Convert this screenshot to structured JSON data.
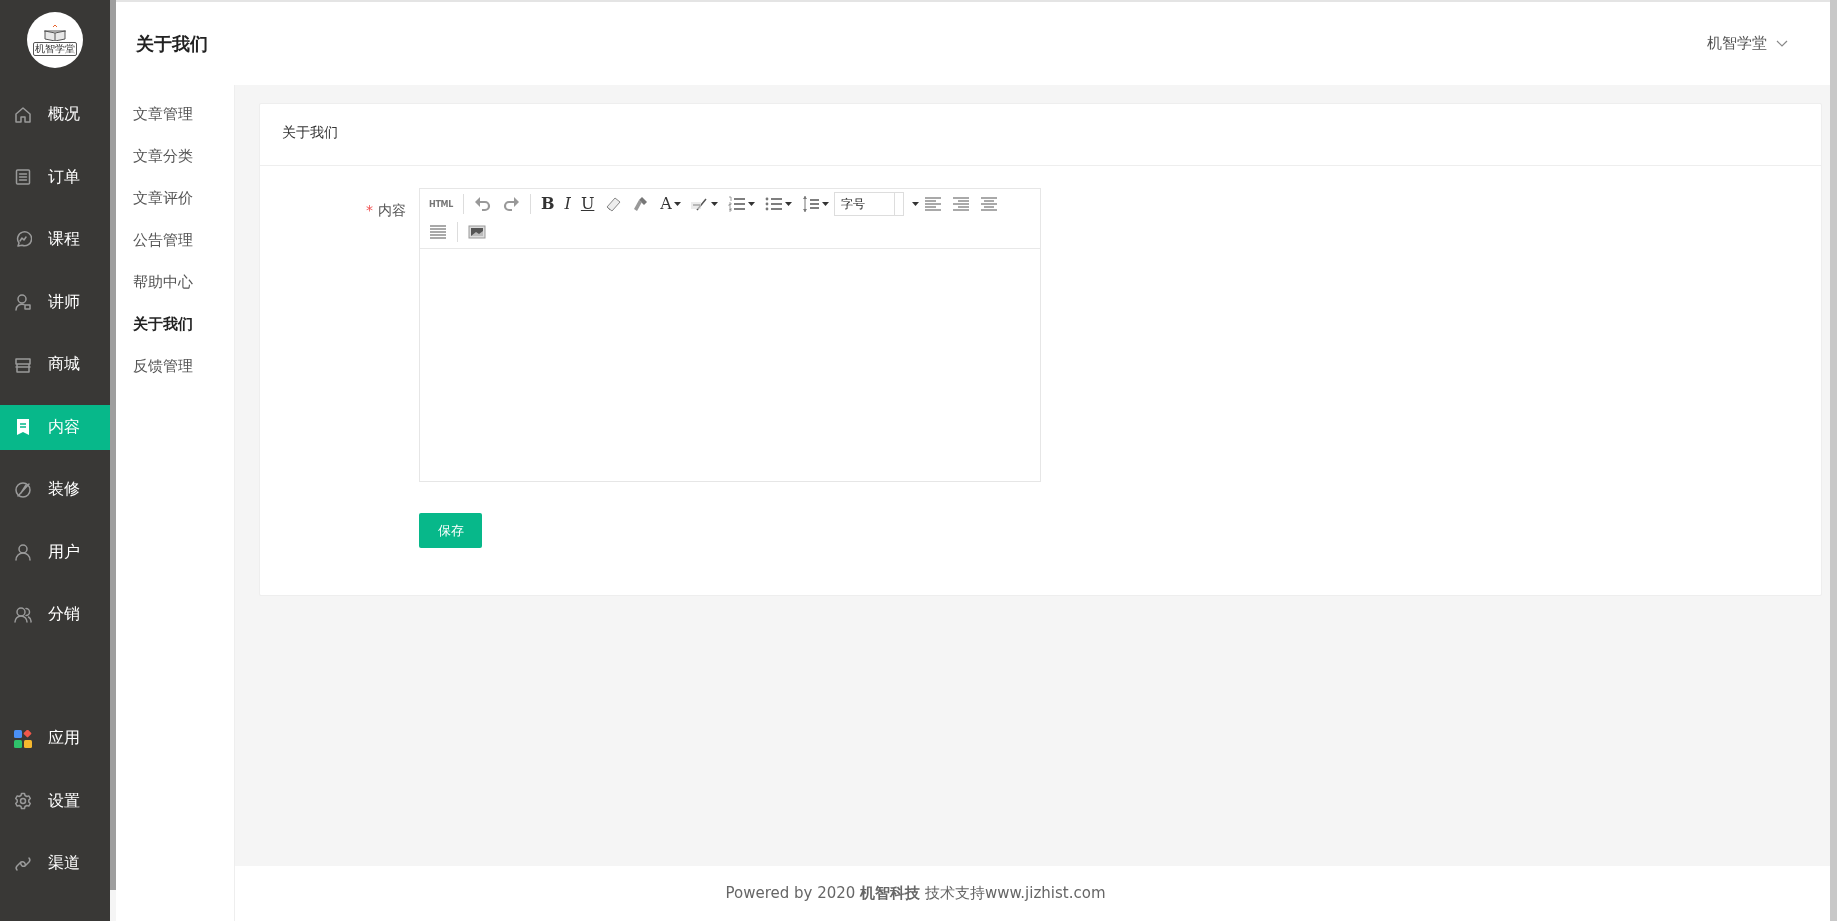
{
  "logo": {
    "text": "机智学堂"
  },
  "sidebar": {
    "items": [
      {
        "label": "概况",
        "selected": false
      },
      {
        "label": "订单",
        "selected": false
      },
      {
        "label": "课程",
        "selected": false
      },
      {
        "label": "讲师",
        "selected": false
      },
      {
        "label": "商城",
        "selected": false
      },
      {
        "label": "内容",
        "selected": true
      },
      {
        "label": "装修",
        "selected": false
      },
      {
        "label": "用户",
        "selected": false
      },
      {
        "label": "分销",
        "selected": false
      }
    ],
    "bottom_items": [
      {
        "label": "应用",
        "selected": false
      },
      {
        "label": "设置",
        "selected": false
      },
      {
        "label": "渠道",
        "selected": false
      }
    ]
  },
  "header": {
    "title": "关于我们",
    "user": "机智学堂"
  },
  "subnav": {
    "items": [
      {
        "label": "文章管理",
        "selected": false
      },
      {
        "label": "文章分类",
        "selected": false
      },
      {
        "label": "文章评价",
        "selected": false
      },
      {
        "label": "公告管理",
        "selected": false
      },
      {
        "label": "帮助中心",
        "selected": false
      },
      {
        "label": "关于我们",
        "selected": true
      },
      {
        "label": "反馈管理",
        "selected": false
      }
    ]
  },
  "card": {
    "title": "关于我们",
    "field": {
      "label": "内容",
      "required_mark": "*"
    },
    "toolbar": [
      {
        "kind": "label",
        "text": "HTML"
      },
      {
        "kind": "separator"
      },
      {
        "kind": "icon"
      },
      {
        "kind": "icon"
      },
      {
        "kind": "separator"
      },
      {
        "kind": "glyph",
        "text": "B"
      },
      {
        "kind": "glyph",
        "text": "I"
      },
      {
        "kind": "glyph",
        "text": "U"
      },
      {
        "kind": "icon"
      },
      {
        "kind": "icon"
      },
      {
        "kind": "glyph",
        "text": "A",
        "dropdown": true
      },
      {
        "kind": "icon",
        "dropdown": true
      },
      {
        "kind": "icon",
        "dropdown": true
      },
      {
        "kind": "icon",
        "dropdown": true
      },
      {
        "kind": "icon",
        "dropdown": true
      },
      {
        "kind": "select",
        "value": "字号"
      },
      {
        "kind": "icon"
      },
      {
        "kind": "icon"
      },
      {
        "kind": "icon"
      },
      {
        "kind": "break"
      },
      {
        "kind": "icon"
      },
      {
        "kind": "separator"
      },
      {
        "kind": "icon"
      }
    ],
    "save_button": "保存"
  },
  "footer": {
    "text": "Powered by 2020 **机智科技** 技术支持www.jizhist.com"
  }
}
